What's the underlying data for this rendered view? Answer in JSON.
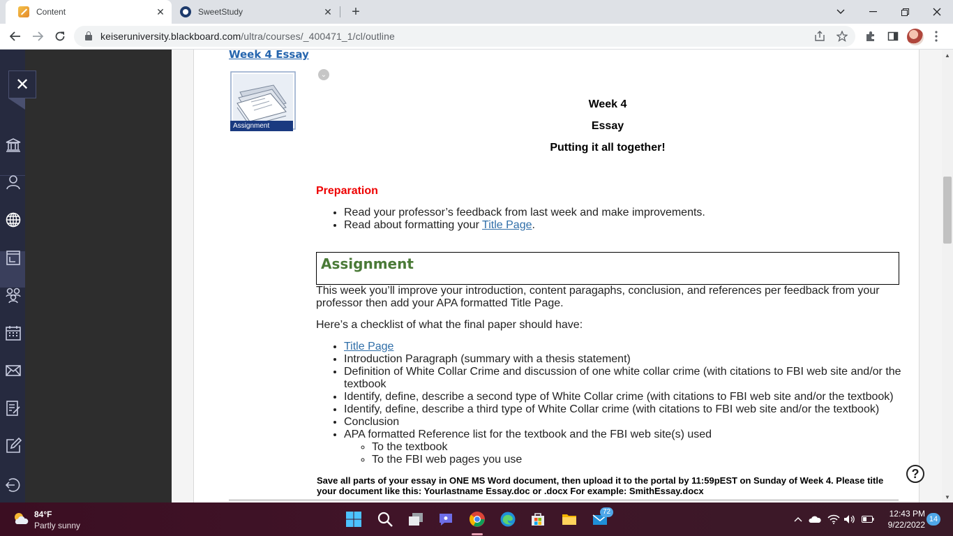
{
  "browser": {
    "tabs": [
      {
        "title": "Content",
        "active": true
      },
      {
        "title": "SweetStudy",
        "active": false
      }
    ],
    "url_host": "keiseruniversity.blackboard.com",
    "url_path": "/ultra/courses/_400471_1/cl/outline"
  },
  "course_item": {
    "title": "Week 4 Essay",
    "icon_label": "Assignment"
  },
  "heading": {
    "line1": "Week 4",
    "line2": "Essay",
    "line3": "Putting it all together!"
  },
  "preparation": {
    "title": "Preparation",
    "item1": "Read your professor’s feedback from last week and make improvements.",
    "item2_prefix": "Read about formatting your ",
    "item2_link": "Title Page",
    "item2_suffix": "."
  },
  "assignment": {
    "title": "Assignment",
    "intro": "This week you’ll improve your introduction, content paragaphs, conclusion, and references per feedback from your professor then add your APA formatted Title Page.",
    "checklist_intro": "Here’s a checklist of what the final paper should have:",
    "checklist": {
      "link": "Title Page",
      "i2": "Introduction Paragraph (summary with a thesis statement)",
      "i3": "Definition of White Collar Crime and discussion of one white collar crime (with citations to FBI web site and/or the textbook",
      "i4": "Identify, define, describe a second type of White Collar crime (with citations to FBI web site and/or the textbook)",
      "i5": "Identify, define, describe a third type of White Collar crime (with citations to FBI web site and/or the textbook)",
      "i6": "Conclusion",
      "i7": "APA formatted Reference list for the textbook and the FBI web site(s) used",
      "sub1": "To the textbook",
      "sub2": "To the FBI web pages you use"
    },
    "note": "Save all parts of your essay in ONE MS Word document, then upload it to the portal by 11:59pEST on Sunday of Week 4.  Please title your document like this:  Yourlastname Essay.doc or .docx  For example: SmithEssay.docx"
  },
  "taskbar": {
    "temp": "84°F",
    "weather": "Partly sunny",
    "mail_badge": "72",
    "time": "12:43 PM",
    "date": "9/22/2022",
    "notifications": "14"
  }
}
